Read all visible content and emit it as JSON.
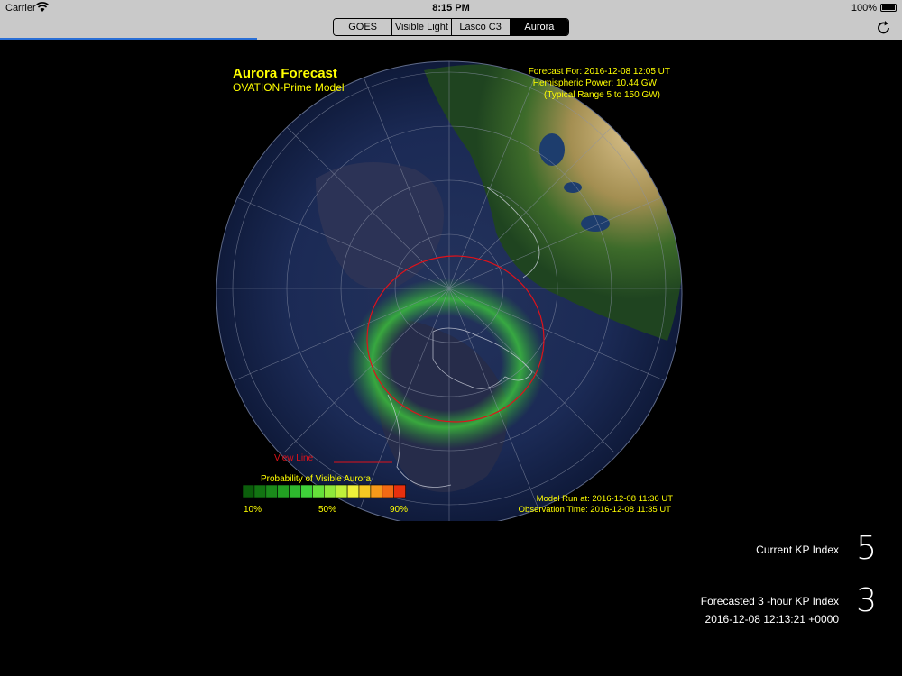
{
  "status_bar": {
    "carrier": "Carrier",
    "time": "8:15 PM",
    "battery": "100%"
  },
  "nav": {
    "segments": [
      "GOES",
      "Visible Light",
      "Lasco C3",
      "Aurora"
    ],
    "selected_index": 3,
    "load_progress": 0.285
  },
  "map": {
    "title": "Aurora Forecast",
    "subtitle": "OVATION-Prime Model",
    "forecast_for": "Forecast For: 2016-12-08 12:05 UT",
    "hemispheric_power": "Hemispheric Power: 10.44 GW",
    "typical_range": "(Typical Range 5 to 150 GW)",
    "view_line_label": "View Line",
    "probability_label": "Probability of Visible Aurora",
    "scale_min": "10%",
    "scale_mid": "50%",
    "scale_max": "90%",
    "model_run": "Model Run at: 2016-12-08 11:36 UT",
    "observation_time": "Observation Time: 2016-12-08 11:35 UT",
    "title_color": "#ffff00",
    "view_line_color": "#e0121a"
  },
  "kp": {
    "current_label": "Current KP Index",
    "current_value": "5",
    "forecast_label": "Forecasted 3 -hour KP Index",
    "forecast_value": "3",
    "timestamp": "2016-12-08 12:13:21 +0000"
  }
}
